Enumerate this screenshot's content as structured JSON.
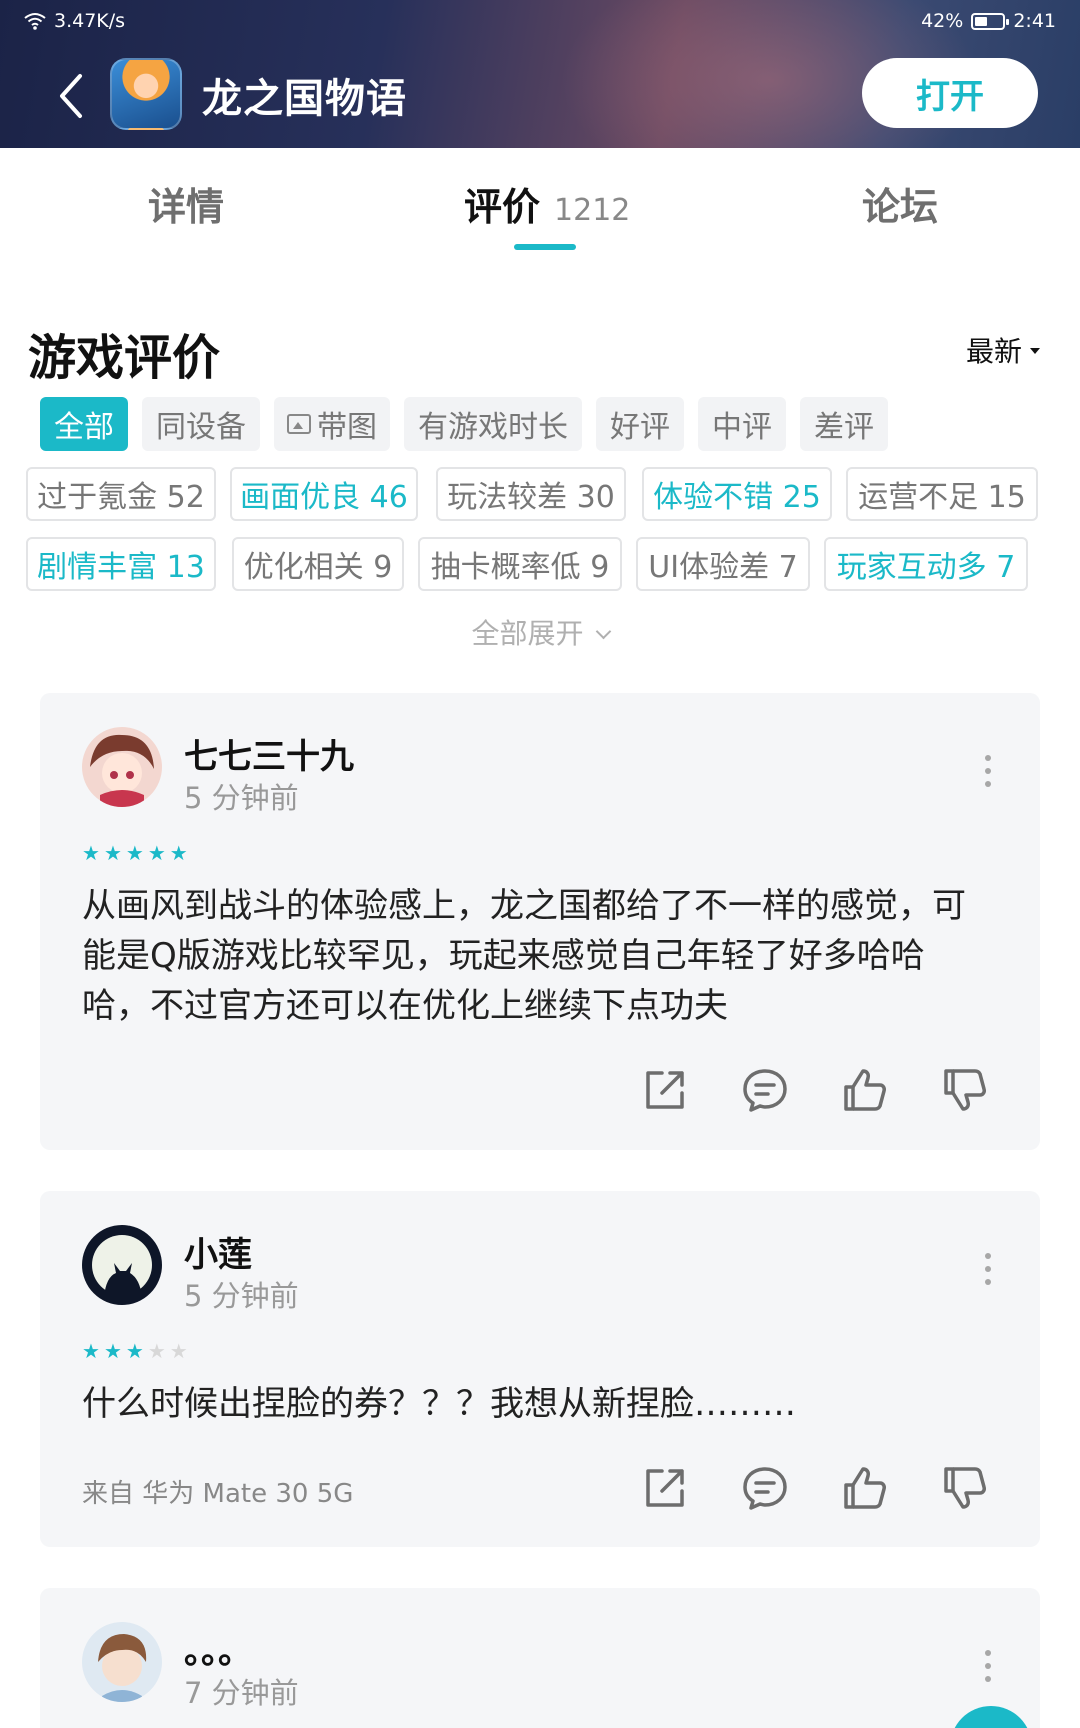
{
  "status_bar": {
    "network_speed": "3.47K/s",
    "battery": "42%",
    "time": "2:41"
  },
  "header": {
    "title": "龙之国物语",
    "open_label": "打开"
  },
  "tabs": [
    {
      "label": "详情"
    },
    {
      "label": "评价",
      "count": "1212"
    },
    {
      "label": "论坛"
    }
  ],
  "section": {
    "title": "游戏评价",
    "sort_label": "最新"
  },
  "filter_chips": [
    "全部",
    "同设备",
    "带图",
    "有游戏时长",
    "好评",
    "中评",
    "差评"
  ],
  "tags": [
    "过于氪金 52",
    "画面优良 46",
    "玩法较差 30",
    "体验不错 25",
    "运营不足 15",
    "剧情丰富 13",
    "优化相关 9",
    "抽卡概率低 9",
    "UI体验差 7",
    "玩家互动多 7"
  ],
  "expand_label": "全部展开",
  "reviews": [
    {
      "username": "七七三十九",
      "time": "5 分钟前",
      "rating": 5,
      "text": "从画风到战斗的体验感上，龙之国都给了不一样的感觉，可能是Q版游戏比较罕见，玩起来感觉自己年轻了好多哈哈哈，不过官方还可以在优化上继续下点功夫",
      "device": ""
    },
    {
      "username": "小莲",
      "time": "5 分钟前",
      "rating": 3,
      "text": "什么时候出捏脸的券？？？我想从新捏脸………",
      "device": "来自 华为 Mate 30 5G"
    },
    {
      "username": "。。。",
      "time": "7 分钟前",
      "rating": 0,
      "text": "",
      "device": ""
    }
  ],
  "colors": {
    "accent": "#1bb9c8",
    "card_bg": "#f5f6f8",
    "star_off": "#d8d8d8"
  }
}
